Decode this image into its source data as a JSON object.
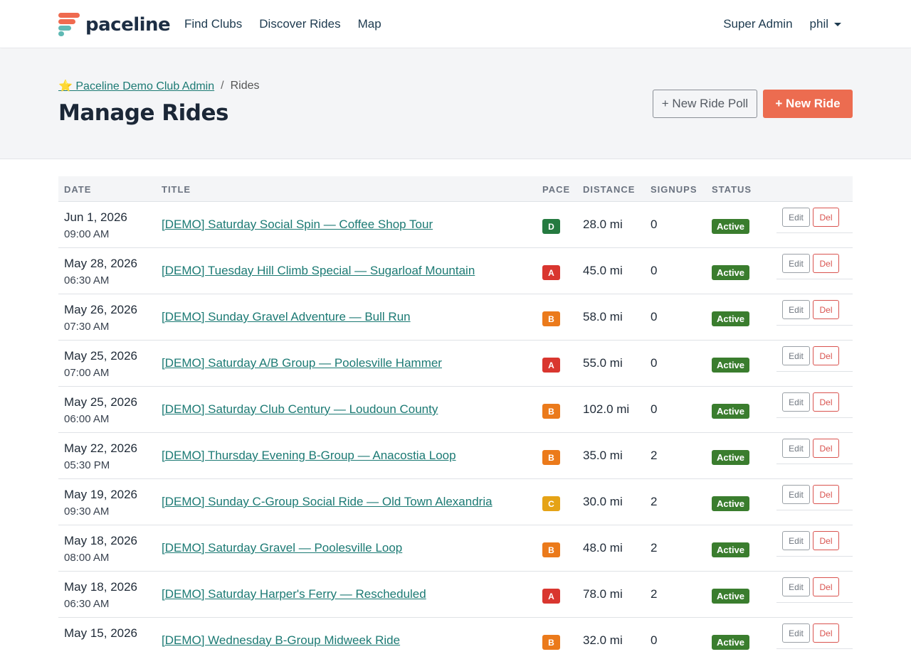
{
  "nav": {
    "brand": "paceline",
    "links": [
      "Find Clubs",
      "Discover Rides",
      "Map"
    ],
    "admin_link": "Super Admin",
    "user": "phil"
  },
  "header": {
    "breadcrumb_club": "⭐ Paceline Demo Club Admin",
    "breadcrumb_sep": "/",
    "breadcrumb_current": "Rides",
    "title": "Manage Rides",
    "new_poll_label": "+ New Ride Poll",
    "new_ride_label": "+ New Ride"
  },
  "table": {
    "columns": [
      "Date",
      "Title",
      "Pace",
      "Distance",
      "Signups",
      "Status"
    ],
    "edit_label": "Edit",
    "del_label": "Del",
    "pace_colors": {
      "A": "#d9362f",
      "B": "#eb7a1b",
      "C": "#e5a316",
      "D": "#257a40"
    },
    "rows": [
      {
        "date": "Jun 1, 2026",
        "time": "09:00 AM",
        "title": "[DEMO] Saturday Social Spin — Coffee Shop Tour",
        "pace": "D",
        "distance": "28.0 mi",
        "signups": "0",
        "status": "Active"
      },
      {
        "date": "May 28, 2026",
        "time": "06:30 AM",
        "title": "[DEMO] Tuesday Hill Climb Special — Sugarloaf Mountain",
        "pace": "A",
        "distance": "45.0 mi",
        "signups": "0",
        "status": "Active"
      },
      {
        "date": "May 26, 2026",
        "time": "07:30 AM",
        "title": "[DEMO] Sunday Gravel Adventure — Bull Run",
        "pace": "B",
        "distance": "58.0 mi",
        "signups": "0",
        "status": "Active"
      },
      {
        "date": "May 25, 2026",
        "time": "07:00 AM",
        "title": "[DEMO] Saturday A/B Group — Poolesville Hammer",
        "pace": "A",
        "distance": "55.0 mi",
        "signups": "0",
        "status": "Active"
      },
      {
        "date": "May 25, 2026",
        "time": "06:00 AM",
        "title": "[DEMO] Saturday Club Century — Loudoun County",
        "pace": "B",
        "distance": "102.0 mi",
        "signups": "0",
        "status": "Active"
      },
      {
        "date": "May 22, 2026",
        "time": "05:30 PM",
        "title": "[DEMO] Thursday Evening B-Group — Anacostia Loop",
        "pace": "B",
        "distance": "35.0 mi",
        "signups": "2",
        "status": "Active"
      },
      {
        "date": "May 19, 2026",
        "time": "09:30 AM",
        "title": "[DEMO] Sunday C-Group Social Ride — Old Town Alexandria",
        "pace": "C",
        "distance": "30.0 mi",
        "signups": "2",
        "status": "Active"
      },
      {
        "date": "May 18, 2026",
        "time": "08:00 AM",
        "title": "[DEMO] Saturday Gravel — Poolesville Loop",
        "pace": "B",
        "distance": "48.0 mi",
        "signups": "2",
        "status": "Active"
      },
      {
        "date": "May 18, 2026",
        "time": "06:30 AM",
        "title": "[DEMO] Saturday Harper's Ferry — Rescheduled",
        "pace": "A",
        "distance": "78.0 mi",
        "signups": "2",
        "status": "Active"
      },
      {
        "date": "May 15, 2026",
        "time": "",
        "title": "[DEMO] Wednesday B-Group Midweek Ride",
        "pace": "B",
        "distance": "32.0 mi",
        "signups": "0",
        "status": "Active"
      }
    ]
  }
}
